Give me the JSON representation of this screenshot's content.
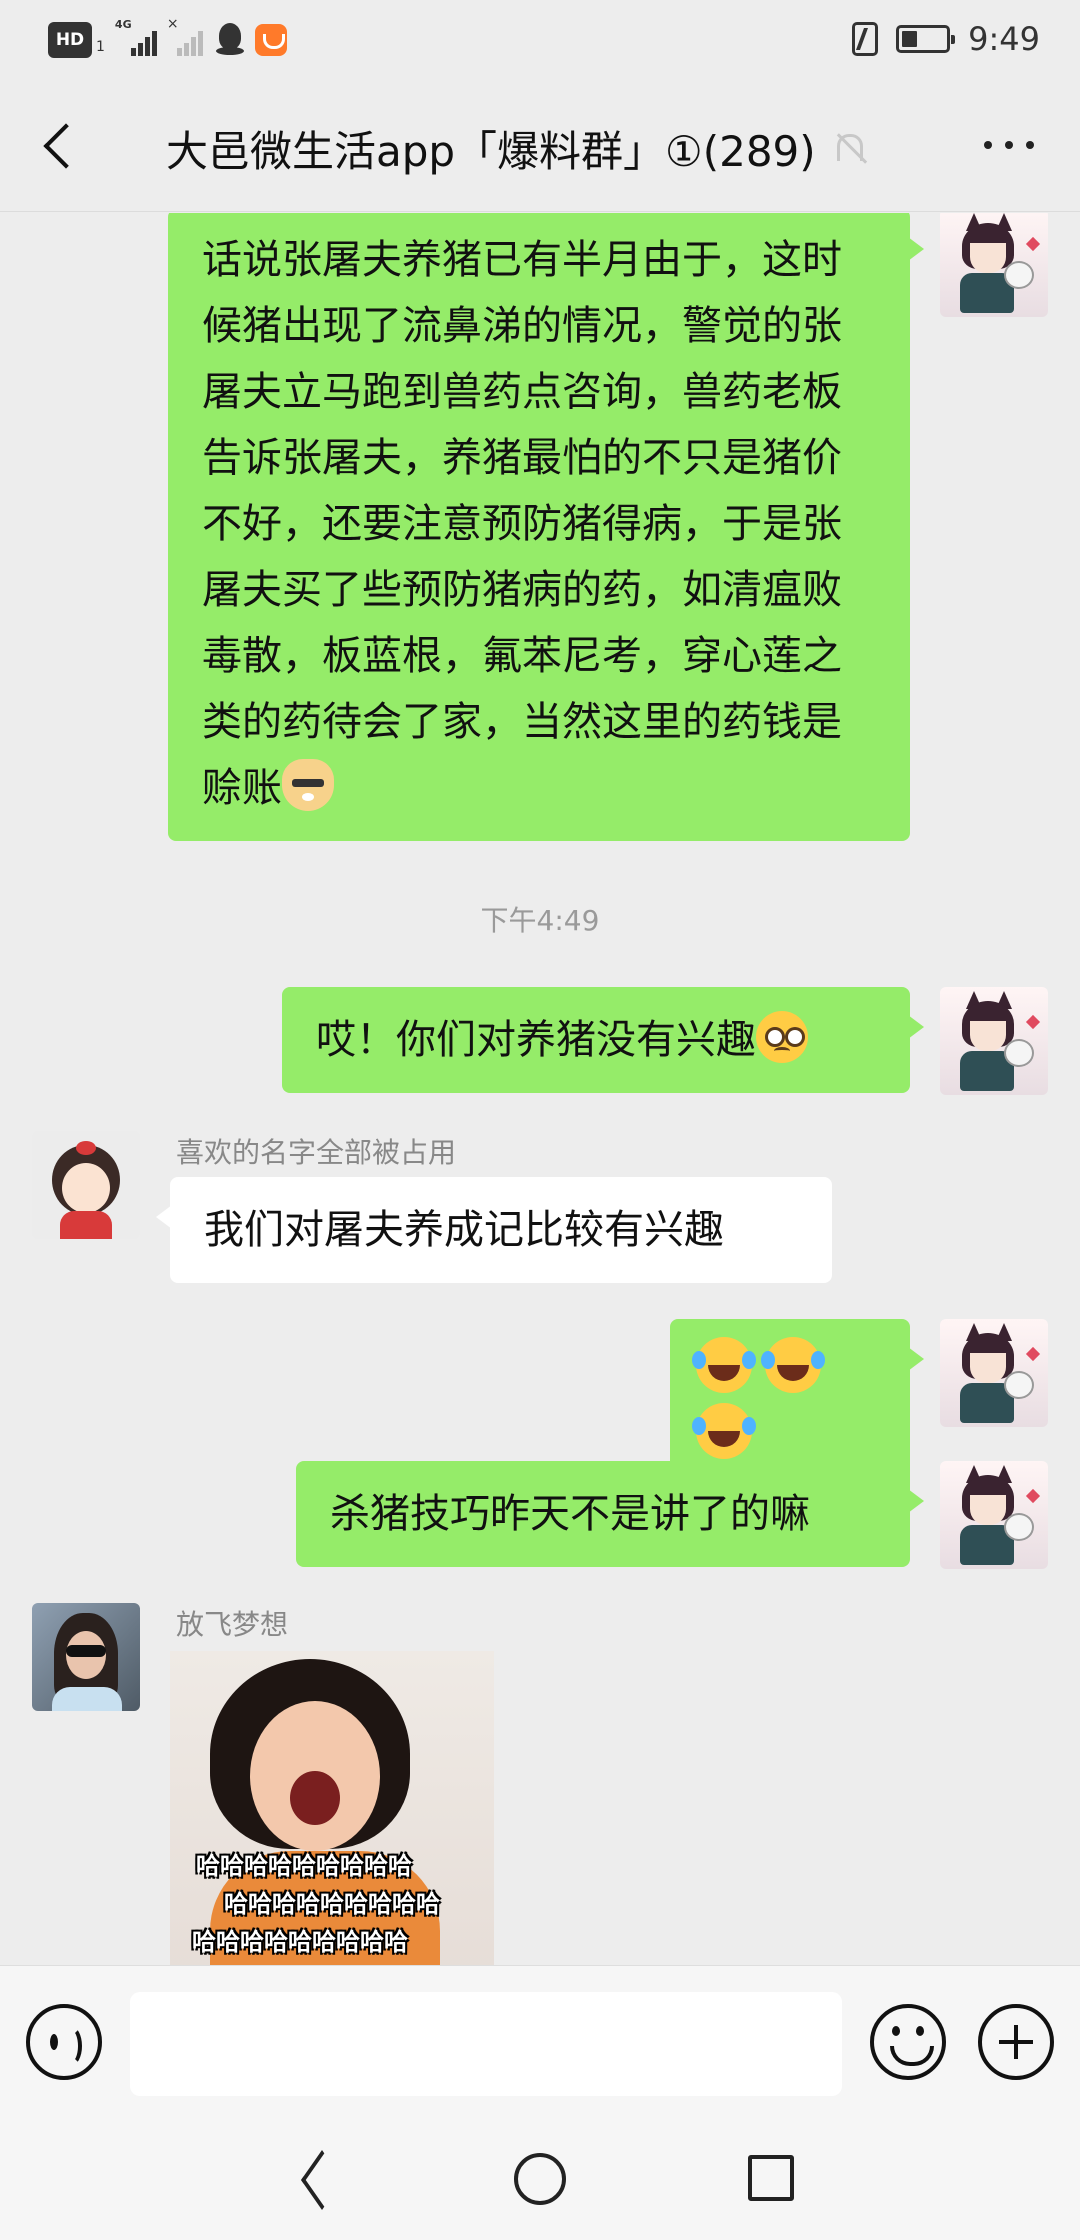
{
  "status_bar": {
    "hd_label": "HD",
    "sim_label": "1",
    "network_label": "4G",
    "time": "9:49",
    "battery_percent": 35
  },
  "header": {
    "title": "大邑微生活app「爆料群」①(289)"
  },
  "messages": [
    {
      "sender": "me",
      "text": "话说张屠夫养猪已有半月由于，这时候猪出现了流鼻涕的情况，警觉的张屠夫立马跑到兽药点咨询，兽药老板告诉张屠夫，养猪最怕的不只是猪价不好，还要注意预防猪得病，于是张屠夫买了些预防猪病的药，如清瘟败毒散，板蓝根，氟苯尼考，穿心莲之类的药待会了家，当然这里的药钱是赊账",
      "trailing_emoji": "doge-emoji"
    },
    {
      "timestamp": "下午4:49"
    },
    {
      "sender": "me",
      "text": "哎！你们对养猪没有兴趣",
      "trailing_emoji": "pleading-face-emoji"
    },
    {
      "sender": "other",
      "nickname": "喜欢的名字全部被占用",
      "text": "我们对屠夫养成记比较有兴趣"
    },
    {
      "sender": "me",
      "emojis": [
        "laugh-cry-emoji",
        "laugh-cry-emoji",
        "laugh-cry-emoji"
      ]
    },
    {
      "sender": "me",
      "text": "杀猪技巧昨天不是讲了的嘛"
    },
    {
      "sender": "other",
      "nickname": "放飞梦想",
      "sticker_text": [
        "哈哈哈哈哈哈哈哈哈",
        "哈哈哈哈哈哈哈哈哈",
        "哈哈哈哈哈哈哈哈哈"
      ]
    }
  ],
  "input": {
    "placeholder": "",
    "value": ""
  }
}
